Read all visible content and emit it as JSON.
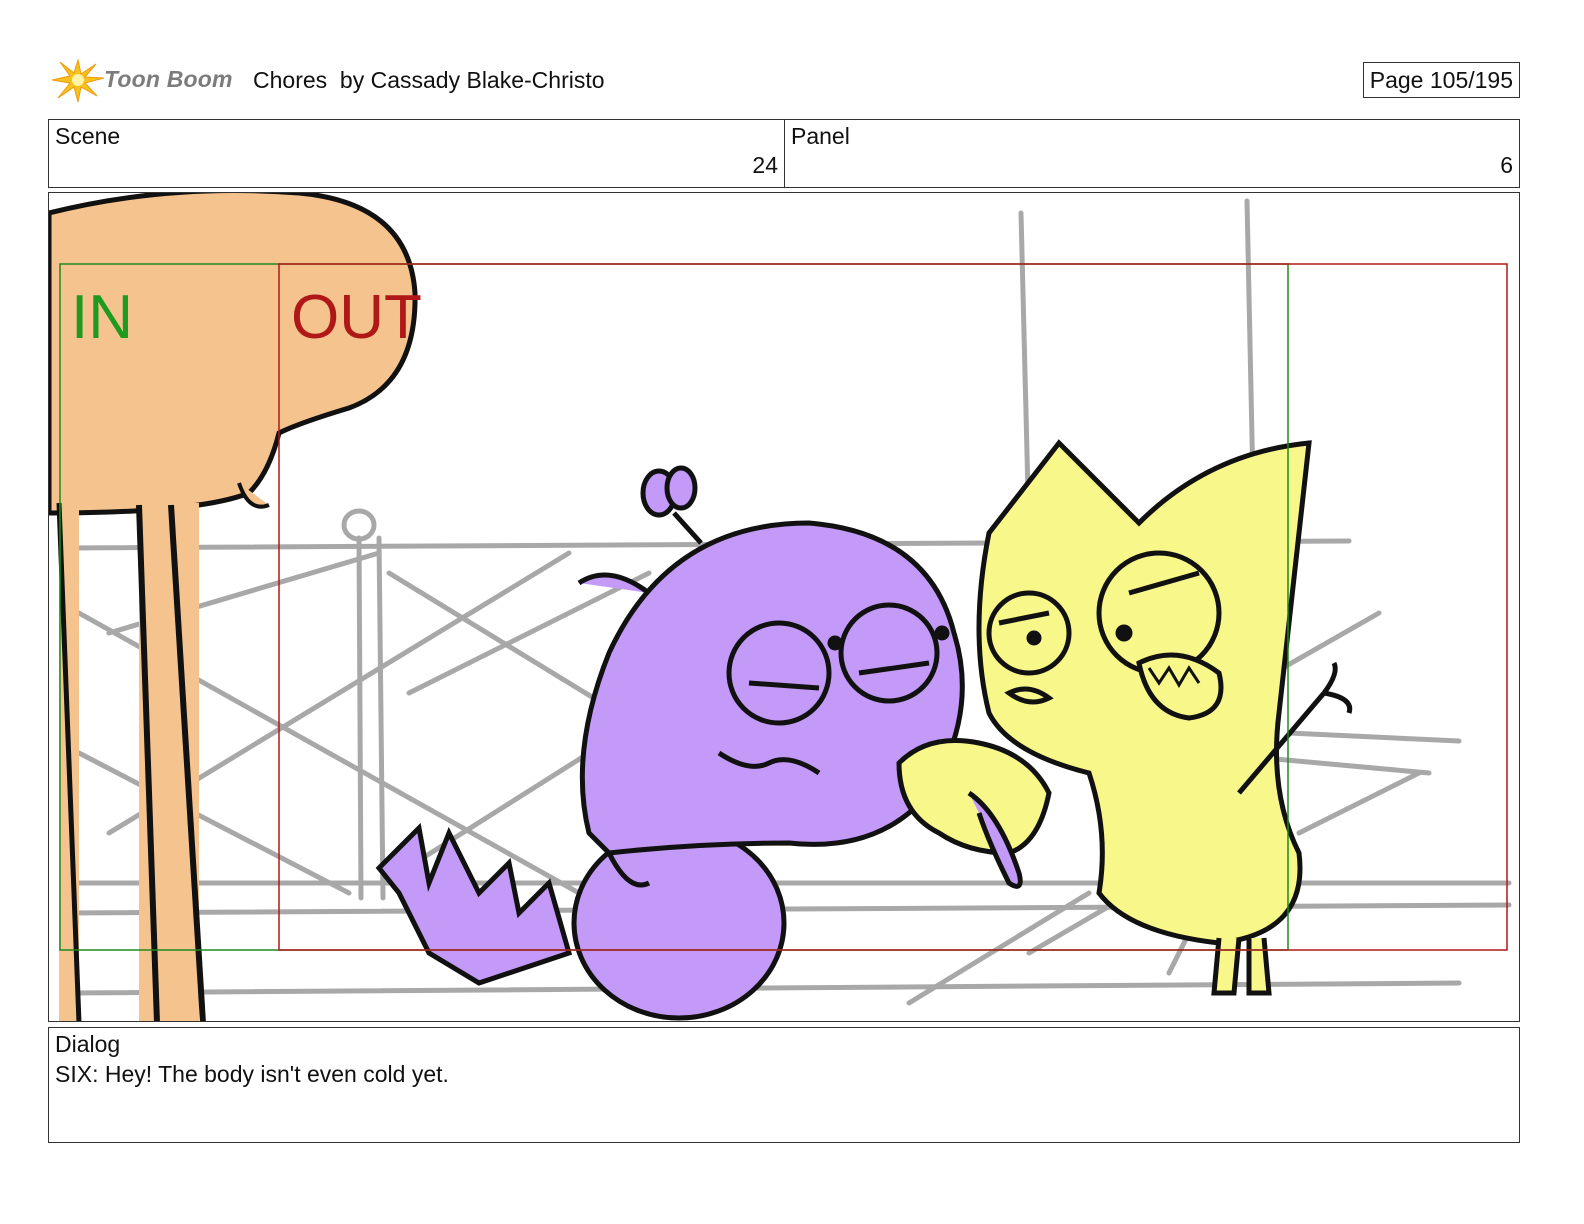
{
  "header": {
    "logo_text": "Toon Boom",
    "title": "Chores  by Cassady Blake-Christo",
    "page": "Page 105/195"
  },
  "info": {
    "scene_label": "Scene",
    "scene_value": "24",
    "panel_label": "Panel",
    "panel_value": "6"
  },
  "panel_image": {
    "in_label": "IN",
    "out_label": "OUT",
    "colors": {
      "in_frame": "#1e8a1e",
      "out_frame": "#b01818",
      "peach": "#f5c48e",
      "purple": "#c39af7",
      "yellow": "#f7f78a",
      "sketch": "#a8a8a8"
    }
  },
  "dialog": {
    "label": "Dialog",
    "text": "SIX: Hey! The body isn't even cold yet."
  }
}
